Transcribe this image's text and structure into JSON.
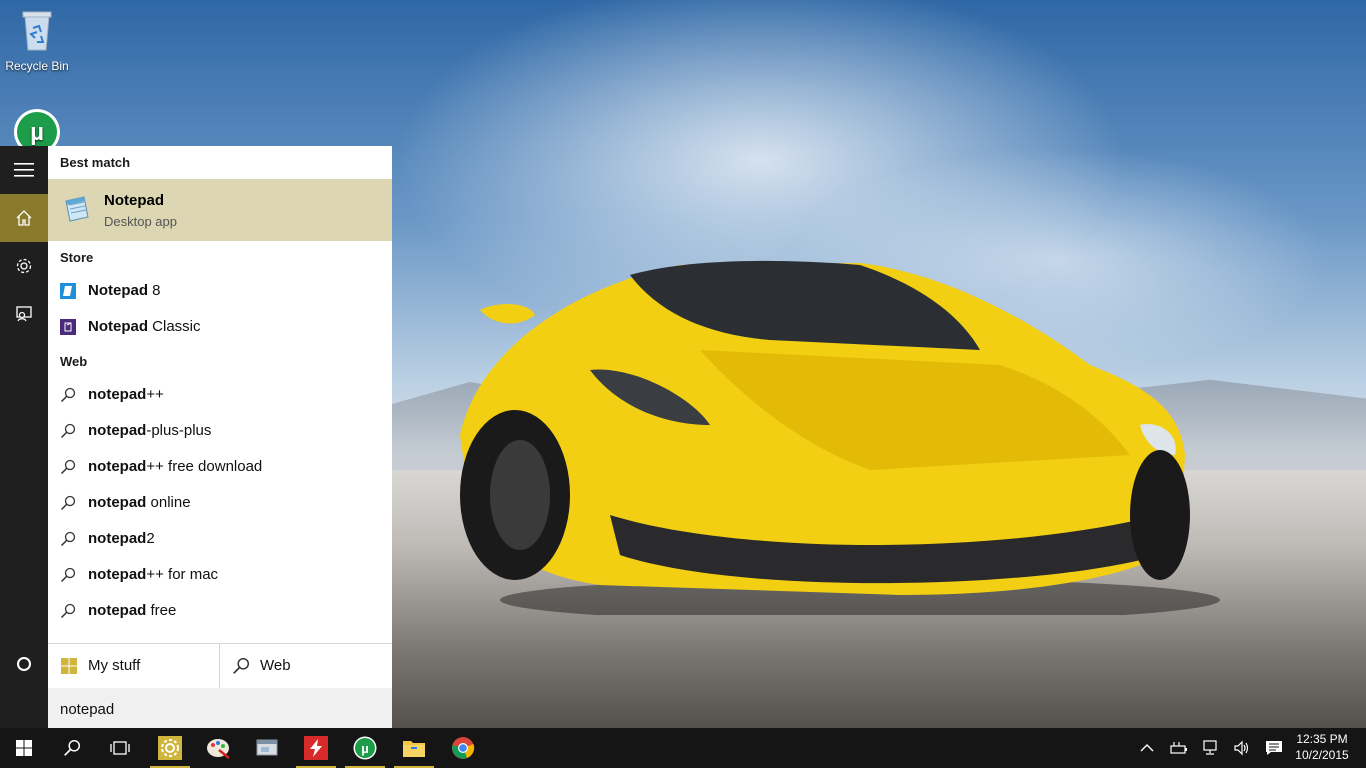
{
  "desktop": {
    "icons": [
      {
        "label": "Recycle Bin",
        "icon": "recycle-bin-icon"
      },
      {
        "label": "",
        "icon": "utorrent-icon"
      }
    ]
  },
  "rail": {
    "items": [
      {
        "name": "menu",
        "icon": "hamburger-icon"
      },
      {
        "name": "home",
        "icon": "home-icon",
        "active": true
      },
      {
        "name": "settings",
        "icon": "gear-icon"
      },
      {
        "name": "feedback",
        "icon": "feedback-icon"
      },
      {
        "name": "cortana",
        "icon": "cortana-circle-icon"
      }
    ]
  },
  "search_panel": {
    "best_match_header": "Best match",
    "best_match": {
      "title": "Notepad",
      "subtitle": "Desktop app",
      "icon": "notepad-icon"
    },
    "store_header": "Store",
    "store_items": [
      {
        "bold": "Notepad",
        "rest": " 8",
        "icon": "notepad8-icon"
      },
      {
        "bold": "Notepad",
        "rest": " Classic",
        "icon": "notepad-classic-icon"
      }
    ],
    "web_header": "Web",
    "web_items": [
      {
        "bold": "notepad",
        "rest": "++"
      },
      {
        "bold": "notepad",
        "rest": "-plus-plus"
      },
      {
        "bold": "notepad",
        "rest": "++ free download"
      },
      {
        "bold": "notepad",
        "rest": " online"
      },
      {
        "bold": "notepad",
        "rest": "2"
      },
      {
        "bold": "notepad",
        "rest": "++ for mac"
      },
      {
        "bold": "notepad",
        "rest": " free"
      }
    ],
    "my_stuff_label": "My stuff",
    "web_label": "Web",
    "query": "notepad"
  },
  "taskbar": {
    "items": [
      {
        "name": "start",
        "icon": "windows-logo-icon"
      },
      {
        "name": "search",
        "icon": "search-icon"
      },
      {
        "name": "task-view",
        "icon": "task-view-icon"
      },
      {
        "name": "app-settings",
        "icon": "settings-app-icon",
        "running": true
      },
      {
        "name": "paint",
        "icon": "paint-icon"
      },
      {
        "name": "app-generic",
        "icon": "window-app-icon"
      },
      {
        "name": "flash-app",
        "icon": "flash-icon",
        "running": true
      },
      {
        "name": "utorrent",
        "icon": "utorrent-icon",
        "running": true
      },
      {
        "name": "file-explorer",
        "icon": "folder-icon",
        "running": true
      },
      {
        "name": "chrome",
        "icon": "chrome-icon"
      }
    ],
    "tray": [
      "chevron-up-icon",
      "power-icon",
      "network-icon",
      "volume-icon",
      "action-center-icon"
    ],
    "time": "12:35 PM",
    "date": "10/2/2015"
  },
  "colors": {
    "accent": "#8a7a2b",
    "best_match_bg": "#dcd6b2",
    "rail_bg": "#1f1f1f",
    "taskbar_bg": "#151515"
  }
}
